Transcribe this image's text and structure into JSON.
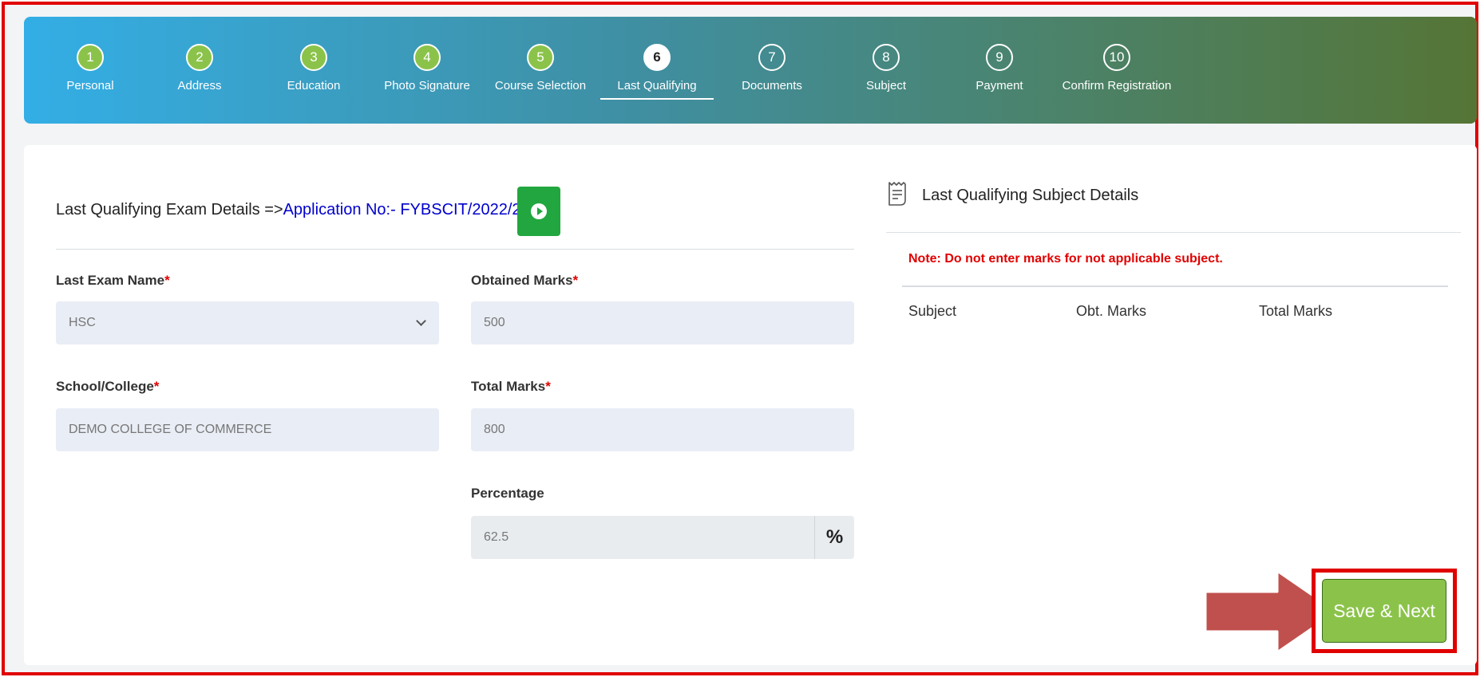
{
  "stepper": {
    "steps": [
      {
        "num": "1",
        "label": "Personal",
        "state": "done"
      },
      {
        "num": "2",
        "label": "Address",
        "state": "done"
      },
      {
        "num": "3",
        "label": "Education",
        "state": "done"
      },
      {
        "num": "4",
        "label": "Photo Signature",
        "state": "done"
      },
      {
        "num": "5",
        "label": "Course Selection",
        "state": "done"
      },
      {
        "num": "6",
        "label": "Last Qualifying",
        "state": "active"
      },
      {
        "num": "7",
        "label": "Documents",
        "state": "todo"
      },
      {
        "num": "8",
        "label": "Subject",
        "state": "todo"
      },
      {
        "num": "9",
        "label": "Payment",
        "state": "todo"
      },
      {
        "num": "10",
        "label": "Confirm Registration",
        "state": "todo"
      }
    ]
  },
  "exam_section": {
    "title": "Last Qualifying Exam Details =>",
    "application_no": "Application No:- FYBSCIT/2022/23/1"
  },
  "form": {
    "last_exam_name": {
      "label": "Last Exam Name",
      "value": "HSC"
    },
    "school_college": {
      "label": "School/College",
      "value": "DEMO COLLEGE OF COMMERCE"
    },
    "obtained_marks": {
      "label": "Obtained Marks",
      "value": "500"
    },
    "total_marks": {
      "label": "Total Marks",
      "value": "800"
    },
    "percentage": {
      "label": "Percentage",
      "value": "62.5",
      "unit": "%"
    },
    "required_mark": "*"
  },
  "subject_section": {
    "title": "Last Qualifying Subject Details",
    "note": "Note: Do not enter marks for not applicable subject.",
    "columns": [
      "Subject",
      "Obt. Marks",
      "Total Marks"
    ]
  },
  "actions": {
    "save_next_label": "Save & Next"
  },
  "colors": {
    "accent_green": "#8bc34a",
    "highlight_red": "#e00000",
    "link_blue": "#0000cc"
  }
}
